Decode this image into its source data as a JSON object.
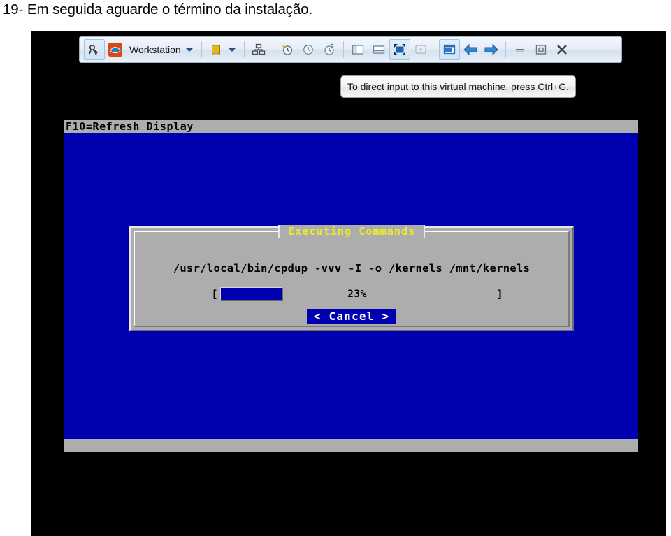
{
  "caption": {
    "text": "19- Em seguida aguarde o término da instalação."
  },
  "vmware_toolbar": {
    "product_label": "Workstation",
    "icons": [
      {
        "name": "vm-power-icon",
        "selected": true
      },
      {
        "name": "vmware-logo-icon",
        "selected": false
      },
      {
        "name": "workstation-dropdown-caret-icon",
        "selected": false
      },
      {
        "name": "suspend-pause-icon",
        "selected": false
      },
      {
        "name": "power-dropdown-caret-icon",
        "selected": false
      },
      {
        "name": "snapshot-manager-icon",
        "selected": false
      },
      {
        "name": "take-snapshot-icon",
        "selected": false
      },
      {
        "name": "revert-snapshot-icon",
        "selected": false
      },
      {
        "name": "manage-snapshots-icon",
        "selected": false
      },
      {
        "name": "show-library-icon",
        "selected": false
      },
      {
        "name": "show-thumbnail-bar-icon",
        "selected": false
      },
      {
        "name": "fullscreen-icon",
        "selected": true
      },
      {
        "name": "unity-mode-icon",
        "selected": false
      },
      {
        "name": "console-view-icon",
        "selected": true
      },
      {
        "name": "back-arrow-icon",
        "selected": false
      },
      {
        "name": "forward-arrow-icon",
        "selected": false
      },
      {
        "name": "minimize-icon",
        "selected": false
      },
      {
        "name": "restore-icon",
        "selected": false
      },
      {
        "name": "close-icon",
        "selected": false
      }
    ]
  },
  "tooltip": {
    "text": "To direct input to this virtual machine, press Ctrl+G."
  },
  "console": {
    "statusbar_text": "F10=Refresh Display",
    "background_color": "#0000b0",
    "bar_color": "#adadad"
  },
  "dialog": {
    "title": "Executing Commands",
    "command": "/usr/local/bin/cpdup -vvv -I -o /kernels /mnt/kernels",
    "progress": {
      "left_bracket": "[",
      "right_bracket": "]",
      "percent_label": "23%",
      "percent_value": 23
    },
    "buttons": [
      {
        "name": "cancel-button",
        "label": "< Cancel >",
        "background_color": "#0000b0",
        "text_color": "#ffffff"
      }
    ],
    "background_color": "#adadad",
    "title_color": "#e8e833"
  }
}
